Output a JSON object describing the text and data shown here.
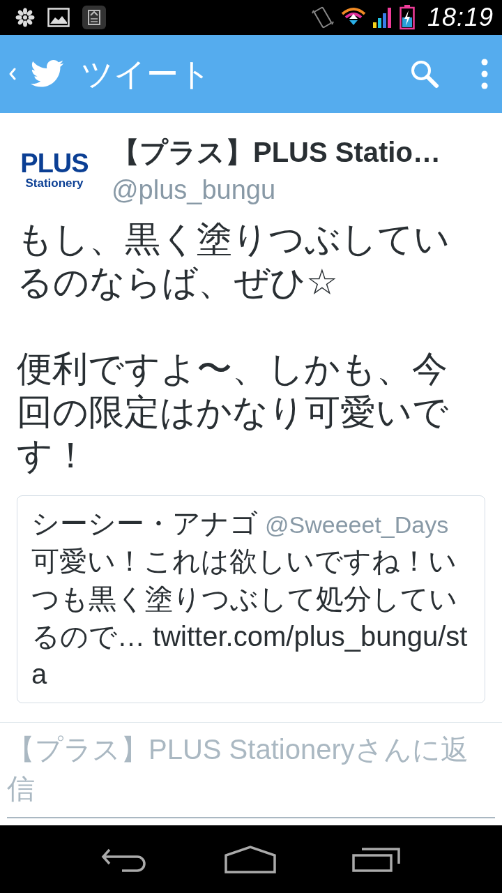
{
  "status_bar": {
    "time": "18:19"
  },
  "app_bar": {
    "title": "ツイート"
  },
  "tweet": {
    "author": {
      "avatar": {
        "line_1": "PLUS",
        "line_2": "Stationery"
      },
      "name": "【プラス】PLUS Statio…",
      "handle": "@plus_bungu"
    },
    "paragraphs": [
      "もし、黒く塗りつぶしているのならば、ぜひ☆",
      "便利ですよ〜、しかも、今回の限定はかなり可愛いです！"
    ],
    "quoted_tweet": {
      "name": "シーシー・アナゴ",
      "handle": "@Sweeeet_Days",
      "text": "可愛い！これは欲しいですね！いつも黒く塗りつぶして処分しているので… twitter.com/plus_bungu/sta"
    }
  },
  "reply": {
    "placeholder": "【プラス】PLUS Stationeryさんに返信"
  }
}
